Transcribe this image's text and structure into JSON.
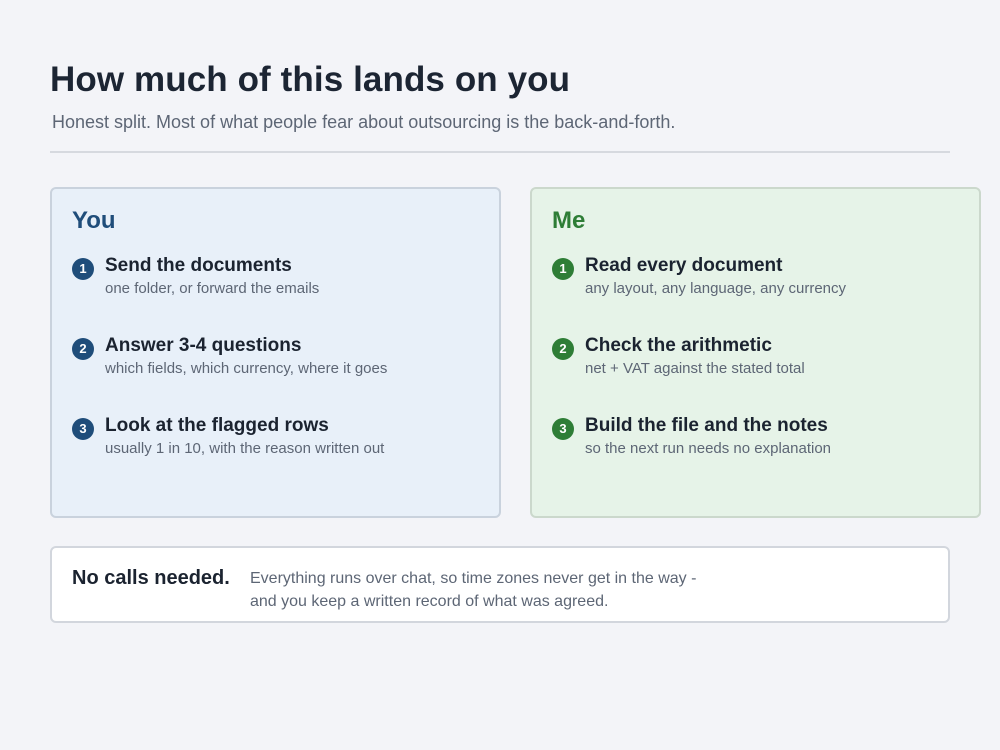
{
  "header": {
    "title": "How much of this lands on you",
    "subtitle": "Honest split. Most of what people fear about outsourcing is the back-and-forth."
  },
  "you": {
    "title": "You",
    "steps": [
      {
        "num": "1",
        "title": "Send the documents",
        "desc": "one folder, or forward the emails"
      },
      {
        "num": "2",
        "title": "Answer 3-4 questions",
        "desc": "which fields, which currency, where it goes"
      },
      {
        "num": "3",
        "title": "Look at the flagged rows",
        "desc": "usually 1 in 10, with the reason written out"
      }
    ]
  },
  "me": {
    "title": "Me",
    "steps": [
      {
        "num": "1",
        "title": "Read every document",
        "desc": "any layout, any language, any currency"
      },
      {
        "num": "2",
        "title": "Check the arithmetic",
        "desc": "net + VAT against the stated total"
      },
      {
        "num": "3",
        "title": "Build the file and the notes",
        "desc": "so the next run needs no explanation"
      }
    ]
  },
  "note": {
    "label": "No calls needed.",
    "lines": [
      "Everything runs over chat, so time zones never get in the way -",
      "and you keep a written record of what was agreed."
    ]
  },
  "colors": {
    "you_accent": "#1f4d7a",
    "me_accent": "#2e7d36",
    "background": "#f3f4f8"
  }
}
